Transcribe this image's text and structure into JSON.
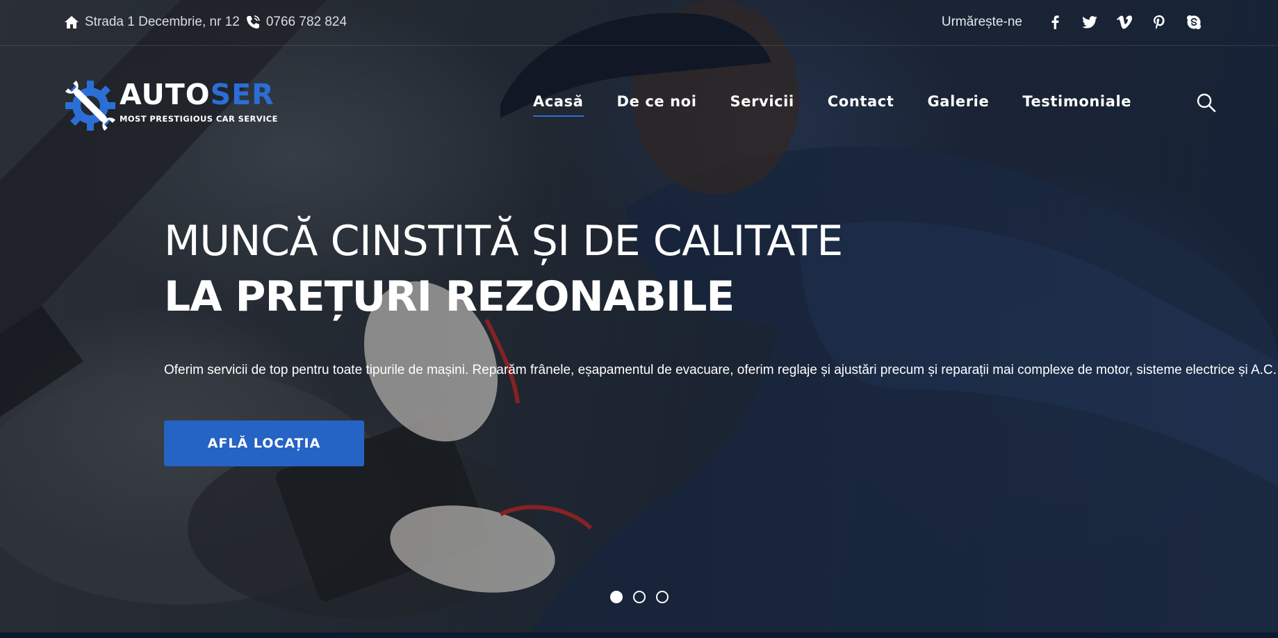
{
  "topbar": {
    "address": "Strada 1 Decembrie, nr 12",
    "phone": "0766 782 824",
    "follow_label": "Urmărește-ne",
    "social_icons": [
      "facebook-icon",
      "twitter-icon",
      "vimeo-icon",
      "pinterest-icon",
      "skype-icon"
    ]
  },
  "logo": {
    "brand_main": "AUTO",
    "brand_accent": "SER",
    "tagline": "MOST PRESTIGIOUS CAR SERVICE"
  },
  "nav": {
    "items": [
      {
        "label": "Acasă",
        "active": true
      },
      {
        "label": "De ce noi"
      },
      {
        "label": "Servicii"
      },
      {
        "label": "Contact"
      },
      {
        "label": "Galerie"
      },
      {
        "label": "Testimoniale"
      }
    ]
  },
  "hero": {
    "headline_line1": "MUNCĂ CINSTITĂ ȘI DE CALITATE",
    "headline_line2": "LA PREȚURI REZONABILE",
    "lead": "Oferim servicii de top pentru toate tipurile de mașini. Reparăm frânele, eșapamentul de evacuare, oferim reglaje și ajustări precum și reparații mai complexe de motor, sisteme electrice și A.C.",
    "cta_label": "AFLĂ LOCAȚIA",
    "slides_total": 3,
    "slide_active": 1
  },
  "colors": {
    "accent": "#2b6fd6",
    "button": "#2563c4"
  }
}
